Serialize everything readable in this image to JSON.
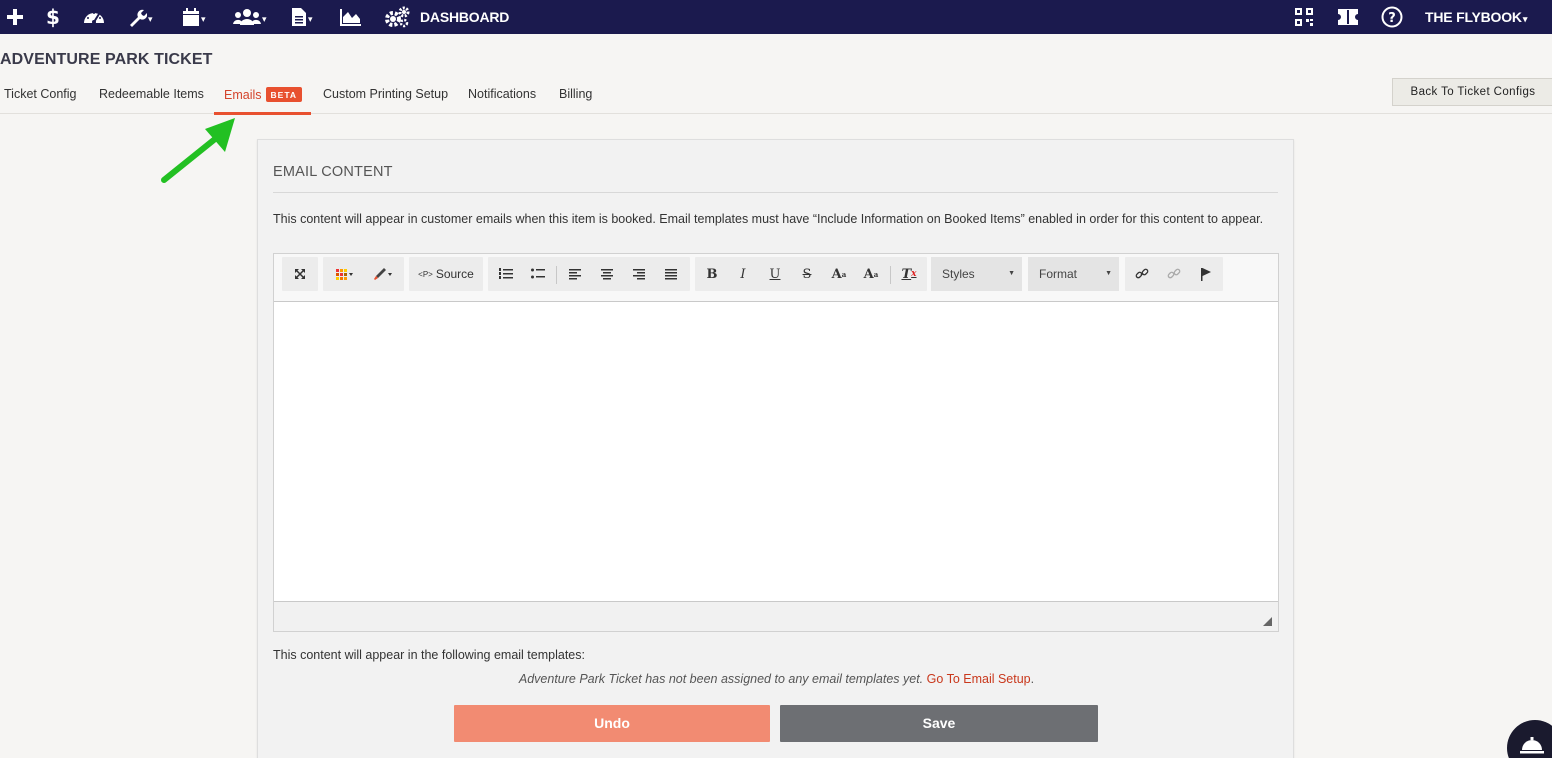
{
  "nav": {
    "dashboard_label": "DASHBOARD",
    "account_label": "THE FLYBOOK",
    "icons": [
      "plus-icon",
      "dollar-icon",
      "speedometer-icon",
      "wrench-icon",
      "calendar-icon",
      "users-icon",
      "document-icon",
      "area-chart-icon",
      "gears-icon",
      "qr-code-icon",
      "ticket-icon",
      "help-icon"
    ],
    "bg_color": "#1b1a4e"
  },
  "page": {
    "title": "ADVENTURE PARK TICKET",
    "back_label": "Back To Ticket Configs"
  },
  "tabs": [
    {
      "label": "Ticket Config"
    },
    {
      "label": "Redeemable Items"
    },
    {
      "label": "Emails",
      "badge": "BETA",
      "active": true
    },
    {
      "label": "Custom Printing Setup"
    },
    {
      "label": "Notifications"
    },
    {
      "label": "Billing"
    }
  ],
  "panel": {
    "title": "EMAIL CONTENT",
    "description": "This content will appear in customer emails when this item is booked. Email templates must have “Include Information on Booked Items” enabled in order for this content to appear.",
    "source_label": "Source",
    "styles_label": "Styles",
    "format_label": "Format",
    "editor_content": "",
    "templates_label": "This content will appear in the following email templates:",
    "not_assigned_text": "Adventure Park Ticket has not been assigned to any email templates yet.",
    "email_setup_link": "Go To Email Setup",
    "period": ".",
    "undo_label": "Undo",
    "save_label": "Save"
  },
  "colors": {
    "accent": "#e8502f",
    "undo": "#f28b72",
    "save": "#6d6f73",
    "annotation_arrow": "#22c022"
  }
}
